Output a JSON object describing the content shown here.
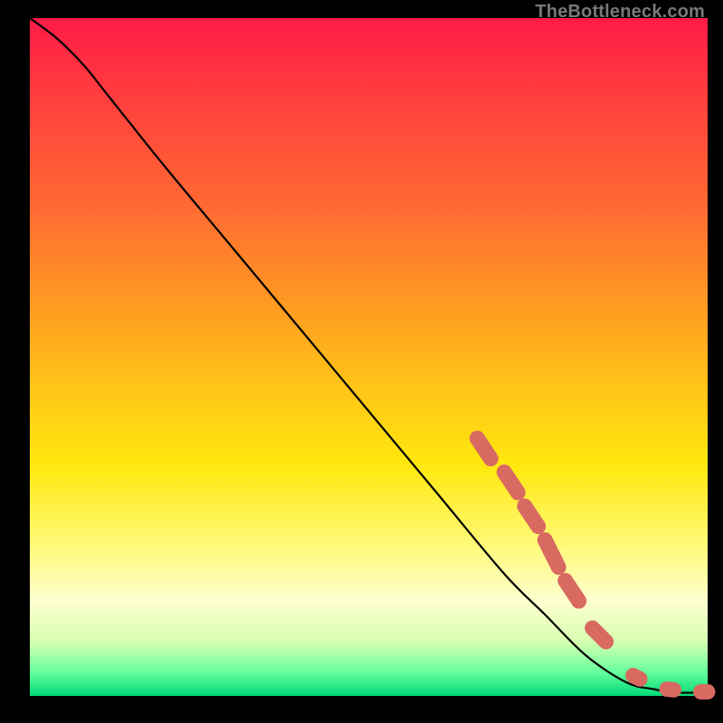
{
  "watermark": "TheBottleneck.com",
  "chart_data": {
    "type": "line",
    "title": "",
    "xlabel": "",
    "ylabel": "",
    "xlim": [
      0,
      100
    ],
    "ylim": [
      0,
      100
    ],
    "curve": {
      "name": "bottleneck-curve",
      "x": [
        0,
        4,
        8,
        12,
        20,
        30,
        40,
        50,
        60,
        70,
        76,
        82,
        88,
        92,
        95,
        100
      ],
      "y": [
        100,
        97,
        93,
        88,
        78,
        66,
        54,
        42,
        30,
        18,
        12,
        6,
        2,
        1,
        0.5,
        0.5
      ]
    },
    "markers": {
      "name": "highlighted-points",
      "color": "#d86a62",
      "points": [
        {
          "x": 66,
          "y": 38
        },
        {
          "x": 68,
          "y": 35
        },
        {
          "x": 70,
          "y": 33
        },
        {
          "x": 72,
          "y": 30
        },
        {
          "x": 73,
          "y": 28
        },
        {
          "x": 75,
          "y": 25
        },
        {
          "x": 76,
          "y": 23
        },
        {
          "x": 78,
          "y": 19
        },
        {
          "x": 79,
          "y": 17
        },
        {
          "x": 81,
          "y": 14
        },
        {
          "x": 83,
          "y": 10
        },
        {
          "x": 85,
          "y": 8
        },
        {
          "x": 89,
          "y": 3.0
        },
        {
          "x": 90,
          "y": 2.5
        },
        {
          "x": 94,
          "y": 1.0
        },
        {
          "x": 95,
          "y": 0.9
        },
        {
          "x": 99,
          "y": 0.6
        },
        {
          "x": 100,
          "y": 0.6
        }
      ]
    }
  }
}
